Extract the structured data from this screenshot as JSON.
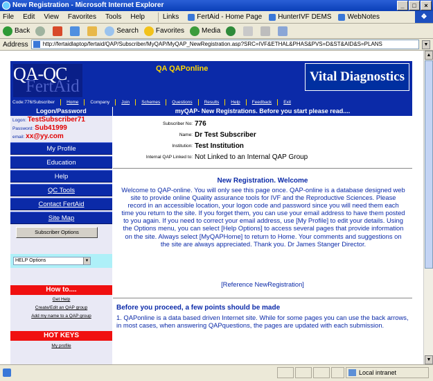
{
  "window": {
    "title": "New Registration - Microsoft Internet Explorer",
    "min": "_",
    "max": "□",
    "close": "×"
  },
  "menu": {
    "items": [
      "File",
      "Edit",
      "View",
      "Favorites",
      "Tools",
      "Help"
    ],
    "links_label": "Links",
    "links": [
      "FertAid - Home Page",
      "HunterIVF DEMS",
      "WebNotes"
    ],
    "overflow": "»"
  },
  "toolbar": {
    "back": "Back",
    "search": "Search",
    "favorites": "Favorites",
    "media": "Media"
  },
  "address": {
    "label": "Address",
    "url": "http://fertaidlaptop/fertaid/QAP/Subscriber/MyQAP/MyQAP_NewRegistration.asp?SRC=IVF&ETHAL&PHAS&PVS=D&ST&AID&S=PLANS"
  },
  "status": {
    "zone": "Local intranet"
  },
  "site": {
    "logo_top": "QA-QC",
    "logo_bottom": "FertAid",
    "name": "QA QAPonline",
    "brand": "Vital Diagnostics",
    "code": "Code:776/Subscriber",
    "nav": [
      "Home",
      "Company",
      "Join",
      "Schemes",
      "Questions",
      "Results",
      "Help",
      "Feedback",
      "Exit"
    ]
  },
  "sidebar": {
    "title": "Logon/Password",
    "logon_label": "Logon:",
    "logon": "TestSubscriber71",
    "password_label": "Password:",
    "password": "Sub41999",
    "email_label": "email:",
    "email": "xx@yy.com",
    "buttons": [
      "My Profile",
      "Education",
      "Help",
      "QC Tools",
      "Contact FertAid",
      "Site Map"
    ],
    "subscriber_options": "Subscriber Options",
    "select_value": "HELP Options",
    "howto_title": "How to....",
    "howto_links": [
      "Get Help",
      "Create/Edit an QAP group",
      "Add my name to a QAP group"
    ],
    "hotkeys_title": "HOT KEYS",
    "hotkeys_links": [
      "My profile"
    ]
  },
  "main": {
    "banner": "myQAP- New Registrations. Before you start please read....",
    "fields": [
      {
        "label": "Subscriber No:",
        "value": "776"
      },
      {
        "label": "Name:",
        "value": "Dr Test Subscriber"
      },
      {
        "label": "Institution:",
        "value": "Test Institution"
      },
      {
        "label": "Internal QAP Linked to:",
        "value": "Not Linked to an Internal QAP Group"
      }
    ],
    "welcome_title": "New Registration. Welcome",
    "welcome_text": "Welcome to QAP-online. You will only see this page once. QAP-online is a database designed web site to provide online Quality assurance tools for IVF and the Reproductive Sciences. Please record in an accessible location, your logon code and password since you will need them each time you return to the site. If you forget them, you can use your email address to have them posted to you again. If you need to correct your email address, use [My Profile] to edit your details. Using the Options menu, you can select [Help Options] to access several pages that provide information on the site. Always select [MyQAPHome] to return to Home. Your comments and suggestions on the site are always appreciated. Thank you. Dr James Stanger Director.",
    "reference": "[Reference NewRegistration]",
    "before_title": "Before you proceed, a few points should be made",
    "point1": "1. QAPonline is a data based driven Internet site. While for some pages you can use the back arrows, in most cases, when answering QAPquestions, the pages are updated with each submission."
  }
}
